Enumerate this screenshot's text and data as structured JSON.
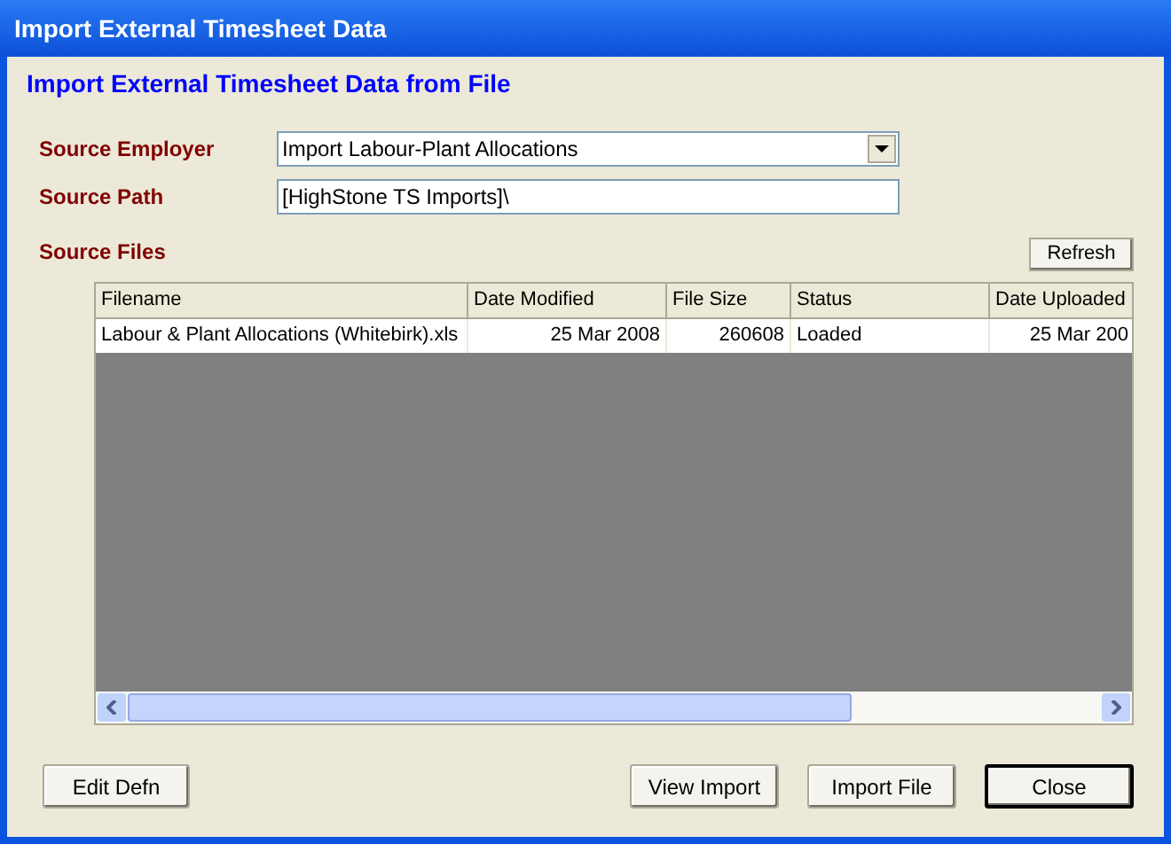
{
  "window": {
    "title": "Import External Timesheet Data"
  },
  "heading": "Import External Timesheet Data from File",
  "source_employer": {
    "label": "Source Employer",
    "value": "Import Labour-Plant Allocations"
  },
  "source_path": {
    "label": "Source Path",
    "value": "[HighStone TS Imports]\\"
  },
  "source_files": {
    "label": "Source Files",
    "refresh": "Refresh"
  },
  "table": {
    "columns": [
      {
        "label": "Filename"
      },
      {
        "label": "Date Modified"
      },
      {
        "label": "File Size"
      },
      {
        "label": "Status"
      },
      {
        "label": "Date Uploaded"
      }
    ],
    "rows": [
      [
        "Labour & Plant Allocations (Whitebirk).xls",
        "25 Mar 2008",
        "260608",
        "Loaded",
        "25 Mar 200"
      ]
    ]
  },
  "buttons": [
    {
      "label": "Edit Defn",
      "default": false
    },
    {
      "label": "View Import",
      "default": false
    },
    {
      "label": "Import File",
      "default": false
    },
    {
      "label": "Close",
      "default": true
    }
  ]
}
